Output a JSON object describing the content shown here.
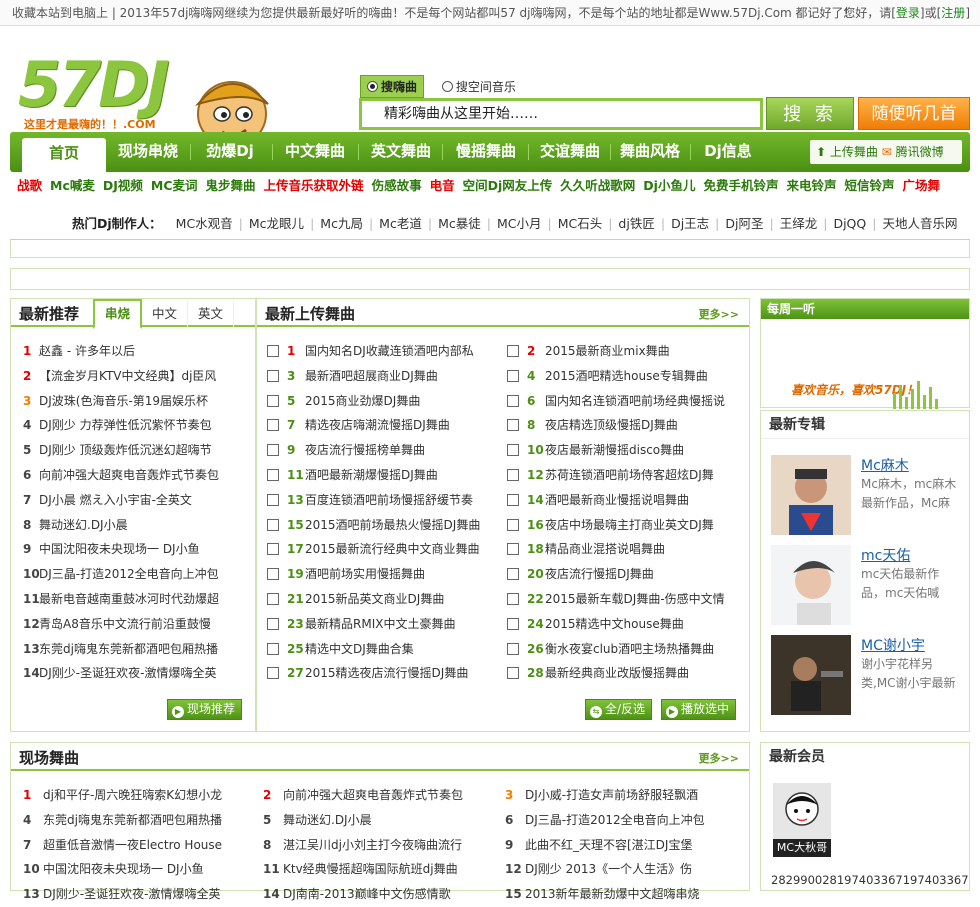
{
  "topbar": {
    "notice": "收藏本站到电脑上 | 2013年57dj嗨嗨网继续为您提供最新最好听的嗨曲！不是每个网站都叫57  dj嗨嗨网，不是每个站的地址都是Www.57Dj.Com 都记好了！",
    "greeting": "您好，请[",
    "login": "登录",
    "or": "]或[",
    "register": "注册",
    "end": "]"
  },
  "logo": {
    "text": "57DJ",
    "slogan": "这里才是最嗨的！！.COM"
  },
  "search": {
    "radio_dj": "搜嗨曲",
    "radio_space": "搜空间音乐",
    "placeholder": "精彩嗨曲从这里开始……",
    "button": "搜 索",
    "random": "随便听几首"
  },
  "nav": {
    "items": [
      "首页",
      "现场串烧",
      "劲爆Dj",
      "中文舞曲",
      "英文舞曲",
      "慢摇舞曲",
      "交谊舞曲",
      "舞曲风格",
      "Dj信息"
    ],
    "upload": "上传舞曲",
    "weibo": "腾讯微博"
  },
  "quicklinks": [
    {
      "t": "战歌",
      "c": "#e60000"
    },
    {
      "t": "Mc喊麦",
      "c": "#2b7a0b"
    },
    {
      "t": "DJ视频",
      "c": "#2b7a0b"
    },
    {
      "t": "MC麦词",
      "c": "#2b7a0b"
    },
    {
      "t": "鬼步舞曲",
      "c": "#2b7a0b"
    },
    {
      "t": "上传音乐获取外链",
      "c": "#e60000"
    },
    {
      "t": "伤感故事",
      "c": "#2b7a0b"
    },
    {
      "t": "电音",
      "c": "#e60000"
    },
    {
      "t": "空间Dj网友上传",
      "c": "#2b7a0b"
    },
    {
      "t": "久久听战歌网",
      "c": "#2b7a0b"
    },
    {
      "t": "Dj小鱼儿",
      "c": "#2b7a0b"
    },
    {
      "t": "免费手机铃声",
      "c": "#2b7a0b"
    },
    {
      "t": "来电铃声",
      "c": "#2b7a0b"
    },
    {
      "t": "短信铃声",
      "c": "#2b7a0b"
    },
    {
      "t": "广场舞",
      "c": "#e60000"
    }
  ],
  "hot_djs": {
    "label": "热门Dj制作人：",
    "names": [
      "MC水观音",
      "Mc龙眼儿",
      "Mc九局",
      "Mc老道",
      "Mc暴徒",
      "MC小月",
      "MC石头",
      "dj铁匠",
      "Dj王志",
      "Dj阿圣",
      "王绎龙",
      "DjQQ",
      "天地人音乐网"
    ]
  },
  "recommend": {
    "title": "最新推荐",
    "tabs": [
      "串烧",
      "中文",
      "英文"
    ],
    "items": [
      "赵鑫 - 许多年以后",
      "【流金岁月KTV中文经典】dj臣风",
      "DJ波珠(色海音乐-第19届娱乐杯",
      "DJ刚少 力荐弹性低沉紫怀节奏包",
      "DJ刚少 顶级轰炸低沉迷幻超嗨节",
      "向前冲强大超爽电音轰炸式节奏包",
      "DJ小晨 燃え入小宇宙-全英文",
      "舞动迷幻.DJ小晨",
      "中国沈阳夜未央现场一 DJ小鱼",
      "DJ三晶-打造2012全电音向上冲包",
      "最新电音越南重鼓冰河时代劲爆超",
      "青岛A8音乐中文流行前沿重鼓慢",
      "东莞dj嗨鬼东莞新都酒吧包厢热播",
      "DJ刚少-圣诞狂欢夜-激情爆嗨全英"
    ],
    "button": "现场推荐"
  },
  "uploads": {
    "title": "最新上传舞曲",
    "more": "更多>>",
    "left": [
      "国内知名DJ收藏连锁酒吧内部私",
      "最新酒吧超展商业DJ舞曲",
      "2015商业劲爆DJ舞曲",
      "精选夜店嗨潮流慢摇DJ舞曲",
      "夜店流行慢摇榜单舞曲",
      "酒吧最新潮爆慢摇DJ舞曲",
      "百度连锁酒吧前场慢摇舒缓节奏",
      "2015酒吧前场最热火慢摇DJ舞曲",
      "2015最新流行经典中文商业舞曲",
      "酒吧前场实用慢摇舞曲",
      "2015新品英文商业DJ舞曲",
      "最新精品RMIX中文土豪舞曲",
      "精选中文DJ舞曲合集",
      "2015精选夜店流行慢摇DJ舞曲"
    ],
    "right": [
      "2015最新商业mix舞曲",
      "2015酒吧精选house专辑舞曲",
      "国内知名连锁酒吧前场经典慢摇说",
      "夜店精选顶级慢摇DJ舞曲",
      "夜店最新潮慢摇disco舞曲",
      "苏荷连锁酒吧前场侍客超炫DJ舞",
      "酒吧最新商业慢摇说唱舞曲",
      "夜店中场最嗨主打商业英文DJ舞",
      "精品商业混搭说唱舞曲",
      "夜店流行慢摇DJ舞曲",
      "2015最新车载DJ舞曲-伤感中文情",
      "2015精选中文house舞曲",
      "衡水夜宴club酒吧主场热播舞曲",
      "最新经典商业改版慢摇舞曲"
    ],
    "select_all": "全/反选",
    "play_selected": "播放选中"
  },
  "weekly": {
    "title": "每周一听",
    "caption": "喜欢音乐，喜欢57DJ！"
  },
  "albums": {
    "title": "最新专辑",
    "items": [
      {
        "name": "Mc麻木",
        "desc": "Mc麻木，mc麻木最新作品，Mc麻"
      },
      {
        "name": "mc天佑",
        "desc": "mc天佑最新作品，mc天佑喊"
      },
      {
        "name": "MC谢小宇",
        "desc": "谢小宇花样另类,MC谢小宇最新"
      }
    ]
  },
  "live": {
    "title": "现场舞曲",
    "more": "更多>>",
    "col1": [
      "dj和平仔-周六晚狂嗨索K幻想小龙",
      "东莞dj嗨鬼东莞新都酒吧包厢热播",
      "超重低音激情一夜Electro House",
      "中国沈阳夜未央现场一 DJ小鱼",
      "DJ刚少-圣诞狂欢夜-激情爆嗨全英"
    ],
    "col2": [
      "向前冲强大超爽电音轰炸式节奏包",
      "舞动迷幻.DJ小晨",
      "湛江吴川dj小刘主打今夜嗨曲流行",
      "Ktv经典慢摇超嗨国际航班dj舞曲",
      "DJ南南-2013巅峰中文伤感情歌"
    ],
    "col3": [
      "DJ小威-打造女声前场舒服轻飘酒",
      "DJ三晶-打造2012全电音向上冲包",
      "此曲不红_天理不容[湛江DJ宝堡",
      "DJ刚少 2013《一个人生活》伤",
      "2013新年最新劲爆中文超嗨串烧"
    ],
    "nums1": [
      "1",
      "4",
      "7",
      "10",
      "13"
    ],
    "nums2": [
      "2",
      "5",
      "8",
      "11",
      "14"
    ],
    "nums3": [
      "3",
      "6",
      "9",
      "12",
      "15"
    ]
  },
  "members": {
    "title": "最新会员",
    "name": "MC大秋哥",
    "number": "282990028197403367197403367"
  },
  "colors": {
    "green": "#8cc63f",
    "darkgreen": "#4b8f13",
    "red": "#e60000",
    "orange": "#f07d05"
  }
}
